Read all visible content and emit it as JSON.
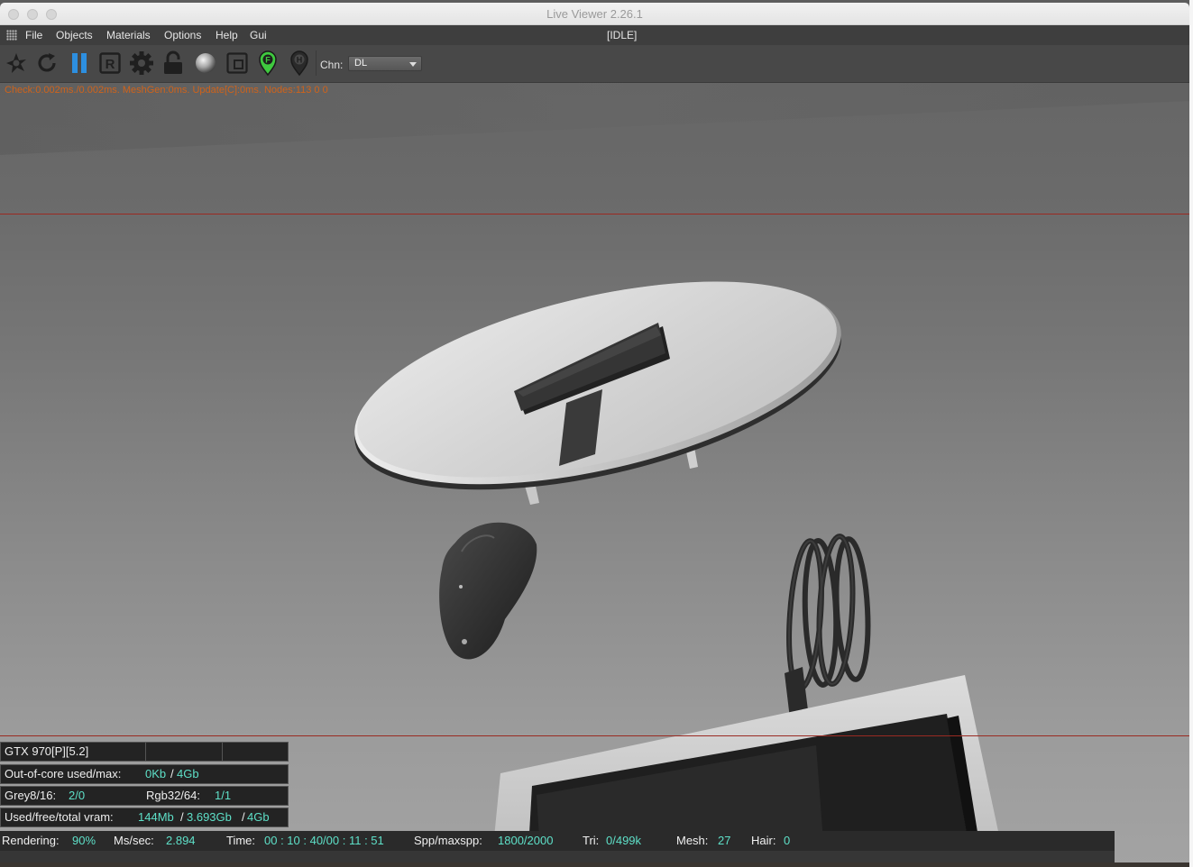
{
  "window": {
    "title": "Live Viewer 2.26.1"
  },
  "menubar": {
    "items": [
      "File",
      "Objects",
      "Materials",
      "Options",
      "Help",
      "Gui"
    ],
    "state": "[IDLE]"
  },
  "toolbar": {
    "buttons": [
      "restart-icon",
      "refresh-icon",
      "pause-icon",
      "r-icon",
      "gear-icon",
      "lock-icon",
      "material-ball-icon",
      "region-icon",
      "focus-pin-icon",
      "hdr-pin-icon"
    ],
    "pin_focus_letter": "F",
    "pin_hdr_letter": "H",
    "r_letter": "R",
    "channel_label": "Chn:",
    "channel_value": "DL"
  },
  "stats_line": "Check:0.002ms./0.002ms. MeshGen:0ms. Update[C]:0ms. Nodes:113  0 0",
  "info": {
    "gpu": "GTX 970[P][5.2]",
    "ooc_label": "Out-of-core used/max:",
    "ooc_used": "0Kb",
    "ooc_max": "4Gb",
    "grey_label": "Grey8/16:",
    "grey_value": "2/0",
    "rgb_label": "Rgb32/64:",
    "rgb_value": "1/1",
    "vram_label": "Used/free/total vram:",
    "vram_used": "144Mb",
    "vram_free": "3.693Gb",
    "vram_total": "4Gb"
  },
  "status": {
    "rendering_label": "Rendering:",
    "rendering_value": "90%",
    "ms_label": "Ms/sec:",
    "ms_value": "2.894",
    "time_label": "Time:",
    "time_value": "00 : 10 : 40/00 : 11 : 51",
    "spp_label": "Spp/maxspp:",
    "spp_value": "1800/2000",
    "tri_label": "Tri:",
    "tri_value": "0/499k",
    "mesh_label": "Mesh:",
    "mesh_value": "27",
    "hair_label": "Hair:",
    "hair_value": "0"
  },
  "colors": {
    "accent_value": "#5ee0c8",
    "stats_text": "#d0631a",
    "pause_blue": "#2d8fe0",
    "pin_green": "#3fc93f",
    "region_line": "#9a2a22"
  }
}
